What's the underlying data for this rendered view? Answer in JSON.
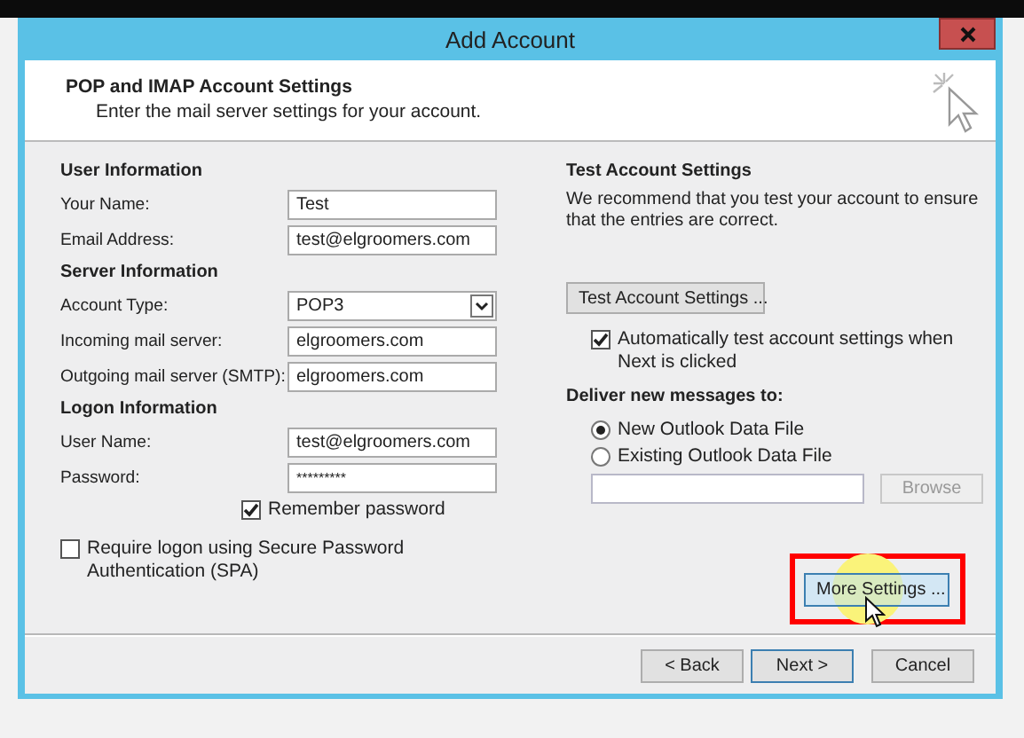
{
  "window": {
    "title": "Add Account"
  },
  "header": {
    "title": "POP and IMAP Account Settings",
    "subtitle": "Enter the mail server settings for your account."
  },
  "left": {
    "sections": [
      {
        "heading": "User Information",
        "fields": [
          {
            "label": "Your Name:",
            "value": "Test",
            "kind": "text"
          },
          {
            "label": "Email Address:",
            "value": "test@elgroomers.com",
            "kind": "text"
          }
        ]
      },
      {
        "heading": "Server Information",
        "fields": [
          {
            "label": "Account Type:",
            "value": "POP3",
            "kind": "dropdown"
          },
          {
            "label": "Incoming mail server:",
            "value": "elgroomers.com",
            "kind": "text"
          },
          {
            "label": "Outgoing mail server (SMTP):",
            "value": "elgroomers.com",
            "kind": "text"
          }
        ]
      },
      {
        "heading": "Logon Information",
        "fields": [
          {
            "label": "User Name:",
            "value": "test@elgroomers.com",
            "kind": "text"
          },
          {
            "label": "Password:",
            "value": "*********",
            "kind": "password"
          }
        ]
      }
    ],
    "remember_password": {
      "label": "Remember password",
      "checked": true
    },
    "require_spa": {
      "label": "Require logon using Secure Password Authentication (SPA)",
      "checked": false
    }
  },
  "right": {
    "heading": "Test Account Settings",
    "description": "We recommend that you test your account to ensure that the entries are correct.",
    "test_button": {
      "label": "Test Account Settings ..."
    },
    "auto_test": {
      "label": "Automatically test account settings when Next is clicked",
      "checked": true
    },
    "deliver_heading": "Deliver new messages to:",
    "deliver_options": [
      {
        "label": "New Outlook Data File",
        "selected": true
      },
      {
        "label": "Existing Outlook Data File",
        "selected": false
      }
    ],
    "browse_button": {
      "label": "Browse",
      "disabled": true
    },
    "more_settings_button": {
      "label": "More Settings ...",
      "hovered": true
    }
  },
  "footer_buttons": [
    {
      "label": "< Back",
      "default": false
    },
    {
      "label": "Next >",
      "default": true
    },
    {
      "label": "Cancel",
      "default": false
    }
  ]
}
